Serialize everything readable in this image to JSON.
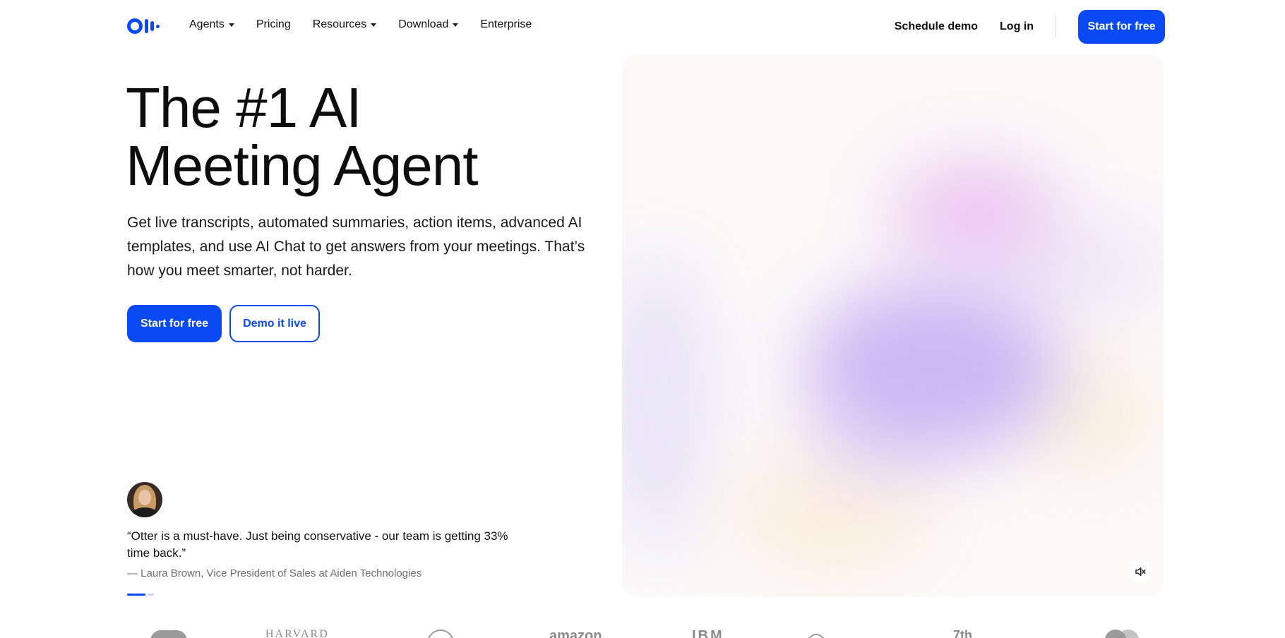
{
  "brand": {
    "logo_icon": "otter-logo-icon",
    "accent": "#0a4af5"
  },
  "nav": {
    "menu": [
      {
        "label": "Agents",
        "dropdown": true
      },
      {
        "label": "Pricing",
        "dropdown": false
      },
      {
        "label": "Resources",
        "dropdown": true
      },
      {
        "label": "Download",
        "dropdown": true
      },
      {
        "label": "Enterprise",
        "dropdown": false
      }
    ],
    "schedule_demo": "Schedule demo",
    "login": "Log in",
    "cta": "Start for free"
  },
  "hero": {
    "title_line1": "The #1 AI",
    "title_line2": "Meeting Agent",
    "subtitle": "Get live transcripts, automated summaries, action items, advanced AI templates, and use AI Chat to get answers from your meetings. That’s how you meet smarter, not harder.",
    "primary_cta": "Start for free",
    "secondary_cta": "Demo it live"
  },
  "testimonial": {
    "quote": "“Otter is a must-have. Just being conservative - our team is getting 33% time back.”",
    "attribution": "— Laura Brown, Vice President of Sales at Aiden Technologies",
    "progress_active_index": 0,
    "progress_total": 2
  },
  "media": {
    "mute_icon": "speaker-muted-icon"
  },
  "logo_strip": [
    {
      "name": "salesforce-logo"
    },
    {
      "name": "harvard-logo",
      "text": "HARVARD"
    },
    {
      "name": "circle-seal-logo"
    },
    {
      "name": "amazon-logo",
      "text": "amazon"
    },
    {
      "name": "ibm-logo",
      "text": "IBM"
    },
    {
      "name": "circle-emblem-logo"
    },
    {
      "name": "wordmark-logo",
      "text": "7th"
    },
    {
      "name": "mastercard-logo"
    }
  ]
}
